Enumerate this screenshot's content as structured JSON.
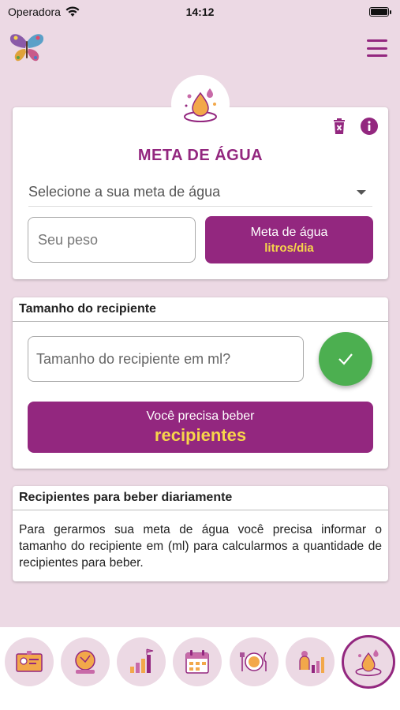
{
  "status_bar": {
    "carrier": "Operadora",
    "time": "14:12",
    "battery_level": 1.0
  },
  "header": {
    "logo_icon": "butterfly-logo-icon",
    "menu_icon": "hamburger-menu-icon"
  },
  "meta_card": {
    "title": "META DE ÁGUA",
    "select_placeholder": "Selecione a sua meta de água",
    "peso_placeholder": "Seu peso",
    "meta_button_line1": "Meta de água",
    "meta_button_line2": "litros/dia"
  },
  "recipient_card": {
    "header": "Tamanho do recipiente",
    "input_placeholder": "Tamanho do recipiente em ml?",
    "result_line1": "Você precisa beber",
    "result_line2": "recipientes"
  },
  "daily_card": {
    "header": "Recipientes para beber diariamente",
    "body": "Para gerarmos sua meta de água você precisa informar o tamanho do recipiente em (ml) para calcularmos a quantidade de recipientes para beber."
  },
  "bottom_nav": [
    {
      "icon": "id-card-icon"
    },
    {
      "icon": "body-scale-icon"
    },
    {
      "icon": "goal-chart-icon"
    },
    {
      "icon": "calendar-icon"
    },
    {
      "icon": "meal-plate-icon"
    },
    {
      "icon": "progress-person-icon"
    },
    {
      "icon": "water-drop-icon",
      "active": true
    }
  ],
  "colors": {
    "background": "#ecd9e4",
    "primary": "#93277f",
    "accent_yellow": "#f7d54a",
    "success_green": "#4caf50"
  }
}
